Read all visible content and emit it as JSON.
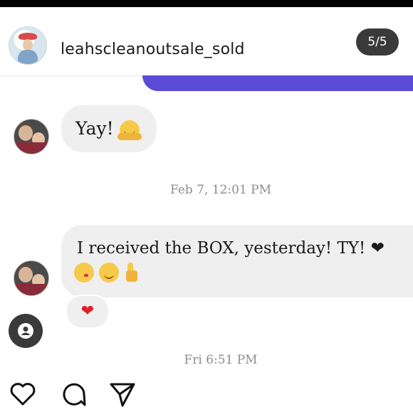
{
  "header": {
    "account_name": "leahscleanoutsale_sold",
    "page_counter": "5/5"
  },
  "messages": [
    {
      "text": "Yay!",
      "emoji": "hugging-face"
    },
    {
      "text": "I received the BOX, yesterday! TY! ❤",
      "emoji": [
        "kissing-face",
        "smiling-face",
        "thumbs-up"
      ]
    }
  ],
  "reaction": {
    "emoji": "❤"
  },
  "timestamps": {
    "first": "Feb 7, 12:01 PM",
    "second": "Fri 6:51 PM"
  },
  "icons": [
    "like-heart-icon",
    "comment-icon",
    "share-icon",
    "user-icon"
  ],
  "colors": {
    "accent": "#5a4ad6",
    "heart": "#e0202a",
    "bubble": "#efefef"
  }
}
